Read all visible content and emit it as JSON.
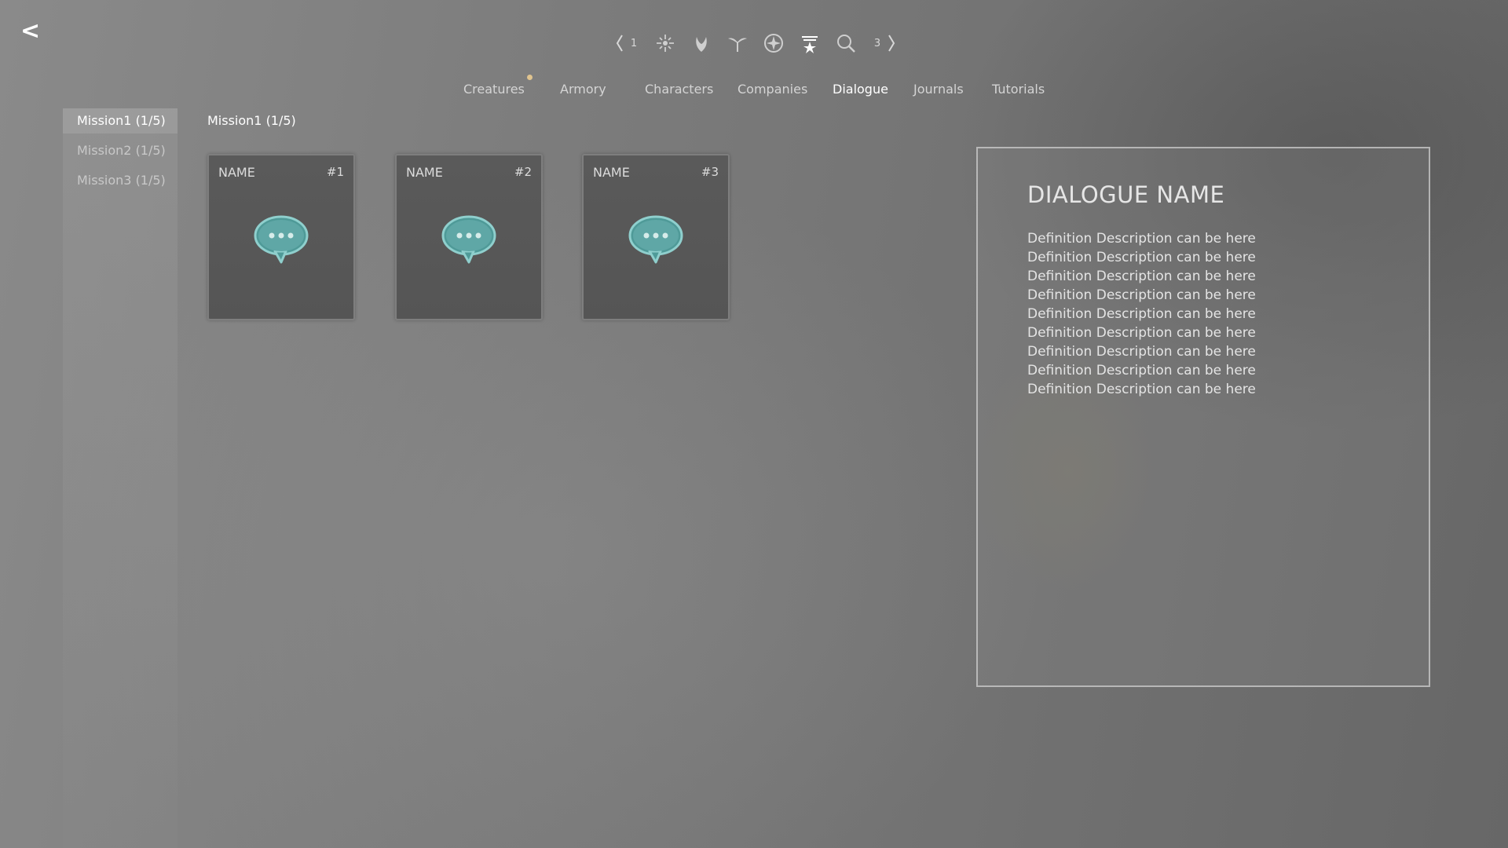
{
  "back_button": {
    "label": "<"
  },
  "icon_bar": {
    "left_hint": "1",
    "right_hint": "3",
    "icons": [
      {
        "name": "left-bracket-icon"
      },
      {
        "name": "sparkle-icon"
      },
      {
        "name": "claw-icon"
      },
      {
        "name": "sprout-icon"
      },
      {
        "name": "compass-icon"
      },
      {
        "name": "star-banner-icon"
      },
      {
        "name": "magnifier-icon"
      },
      {
        "name": "right-bracket-icon"
      }
    ],
    "active_icon": "star-banner-icon"
  },
  "tabs": [
    {
      "label": "Creatures",
      "notification": true
    },
    {
      "label": "Armory",
      "notification": false
    },
    {
      "label": "Characters",
      "notification": false
    },
    {
      "label": "Companies",
      "notification": false
    },
    {
      "label": "Dialogue",
      "notification": false,
      "active": true
    },
    {
      "label": "Journals",
      "notification": false
    },
    {
      "label": "Tutorials",
      "notification": false
    }
  ],
  "sidebar": {
    "items": [
      {
        "label": "Mission1 (1/5)",
        "active": true
      },
      {
        "label": "Mission2 (1/5)",
        "active": false
      },
      {
        "label": "Mission3 (1/5)",
        "active": false
      }
    ]
  },
  "main": {
    "section_title": "Mission1 (1/5)",
    "cards": [
      {
        "name": "NAME",
        "number": "#1",
        "icon": "speech-bubble-icon"
      },
      {
        "name": "NAME",
        "number": "#2",
        "icon": "speech-bubble-icon"
      },
      {
        "name": "NAME",
        "number": "#3",
        "icon": "speech-bubble-icon"
      }
    ]
  },
  "detail": {
    "title": "DIALOGUE NAME",
    "lines": [
      "Definition Description can be here",
      "Definition Description can be here",
      "Definition Description can be here",
      "Definition Description can be here",
      "Definition Description can be here",
      "Definition Description can be here",
      "Definition Description can be here",
      "Definition Description can be here",
      "Definition Description can be here"
    ]
  },
  "colors": {
    "accent_teal": "#5fa7a6",
    "notification_dot": "#e0c48f",
    "active_text": "#ffffff"
  }
}
